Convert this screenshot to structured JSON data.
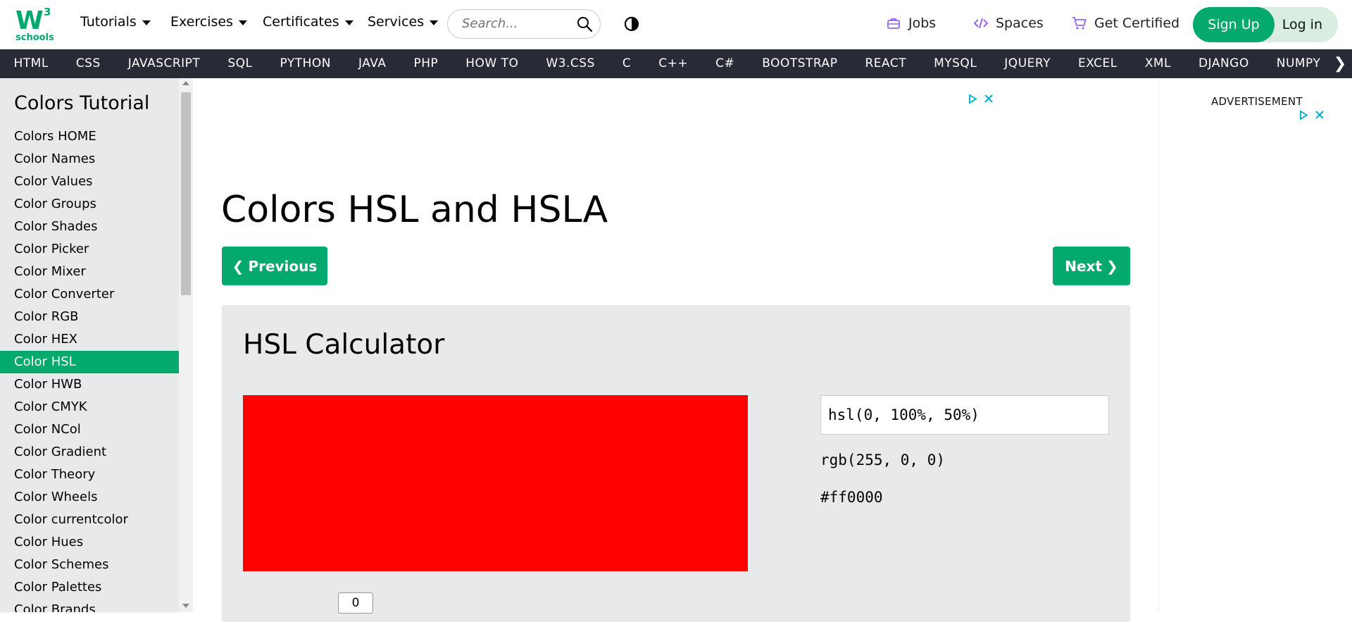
{
  "logo": {
    "mark": "W",
    "superscript": "3",
    "subtext": "schools"
  },
  "top_menu": [
    "Tutorials",
    "Exercises",
    "Certificates",
    "Services"
  ],
  "search": {
    "placeholder": "Search..."
  },
  "top_links": {
    "jobs": "Jobs",
    "spaces": "Spaces",
    "get_certified": "Get Certified"
  },
  "auth": {
    "signup": "Sign Up",
    "login": "Log in"
  },
  "nav": [
    "HTML",
    "CSS",
    "JAVASCRIPT",
    "SQL",
    "PYTHON",
    "JAVA",
    "PHP",
    "HOW TO",
    "W3.CSS",
    "C",
    "C++",
    "C#",
    "BOOTSTRAP",
    "REACT",
    "MYSQL",
    "JQUERY",
    "EXCEL",
    "XML",
    "DJANGO",
    "NUMPY"
  ],
  "sidebar": {
    "title": "Colors Tutorial",
    "items": [
      "Colors HOME",
      "Color Names",
      "Color Values",
      "Color Groups",
      "Color Shades",
      "Color Picker",
      "Color Mixer",
      "Color Converter",
      "Color RGB",
      "Color HEX",
      "Color HSL",
      "Color HWB",
      "Color CMYK",
      "Color NCol",
      "Color Gradient",
      "Color Theory",
      "Color Wheels",
      "Color currentcolor",
      "Color Hues",
      "Color Schemes",
      "Color Palettes",
      "Color Brands"
    ],
    "active_index": 10
  },
  "main": {
    "title": "Colors HSL and HSLA",
    "previous": "Previous",
    "next": "Next",
    "calculator": {
      "title": "HSL Calculator",
      "swatch_color": "#ff0000",
      "hsl_value": "hsl(0, 100%, 50%)",
      "rgb_text": "rgb(255, 0, 0)",
      "hex_text": "#ff0000",
      "hue_value": "0"
    }
  },
  "ads": {
    "label": "ADVERTISEMENT"
  },
  "colors": {
    "accent": "#04AA6D",
    "navbar": "#282A35",
    "sidebar": "#E7E9EB",
    "adicon": "#00aecd"
  }
}
